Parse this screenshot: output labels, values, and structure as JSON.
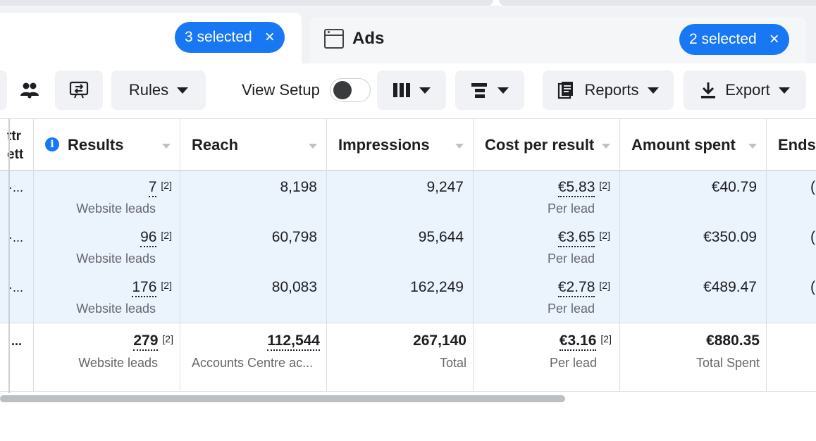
{
  "tabs": {
    "left": {
      "selected_label": "3 selected",
      "close": "×"
    },
    "ads": {
      "label": "Ads",
      "selected_label": "2 selected",
      "close": "×",
      "icon": "ad-frame-icon"
    }
  },
  "toolbar": {
    "rules_label": "Rules",
    "view_setup_label": "View Setup",
    "reports_label": "Reports",
    "export_label": "Export"
  },
  "table": {
    "partial_col": {
      "header_line1": "ttr",
      "header_line2": "ett",
      "ellipsis": "·...",
      "total_ellipsis": "..."
    },
    "columns": {
      "results": "Results",
      "reach": "Reach",
      "impressions": "Impressions",
      "cost_per_result": "Cost per result",
      "amount_spent": "Amount spent",
      "ends": "Ends"
    },
    "rows": [
      {
        "results": "7",
        "results_sup": "[2]",
        "results_sub": "Website leads",
        "reach": "8,198",
        "impressions": "9,247",
        "cost": "€5.83",
        "cost_sup": "[2]",
        "cost_sub": "Per lead",
        "spent": "€40.79",
        "ends": "("
      },
      {
        "results": "96",
        "results_sup": "[2]",
        "results_sub": "Website leads",
        "reach": "60,798",
        "impressions": "95,644",
        "cost": "€3.65",
        "cost_sup": "[2]",
        "cost_sub": "Per lead",
        "spent": "€350.09",
        "ends": "("
      },
      {
        "results": "176",
        "results_sup": "[2]",
        "results_sub": "Website leads",
        "reach": "80,083",
        "impressions": "162,249",
        "cost": "€2.78",
        "cost_sup": "[2]",
        "cost_sub": "Per lead",
        "spent": "€489.47",
        "ends": "("
      }
    ],
    "total": {
      "results": "279",
      "results_sup": "[2]",
      "results_sub": "Website leads",
      "reach": "112,544",
      "reach_sub": "Accounts Centre ac...",
      "impressions": "267,140",
      "impressions_sub": "Total",
      "cost": "€3.16",
      "cost_sup": "[2]",
      "cost_sub": "Per lead",
      "spent": "€880.35",
      "spent_sub": "Total Spent"
    }
  }
}
